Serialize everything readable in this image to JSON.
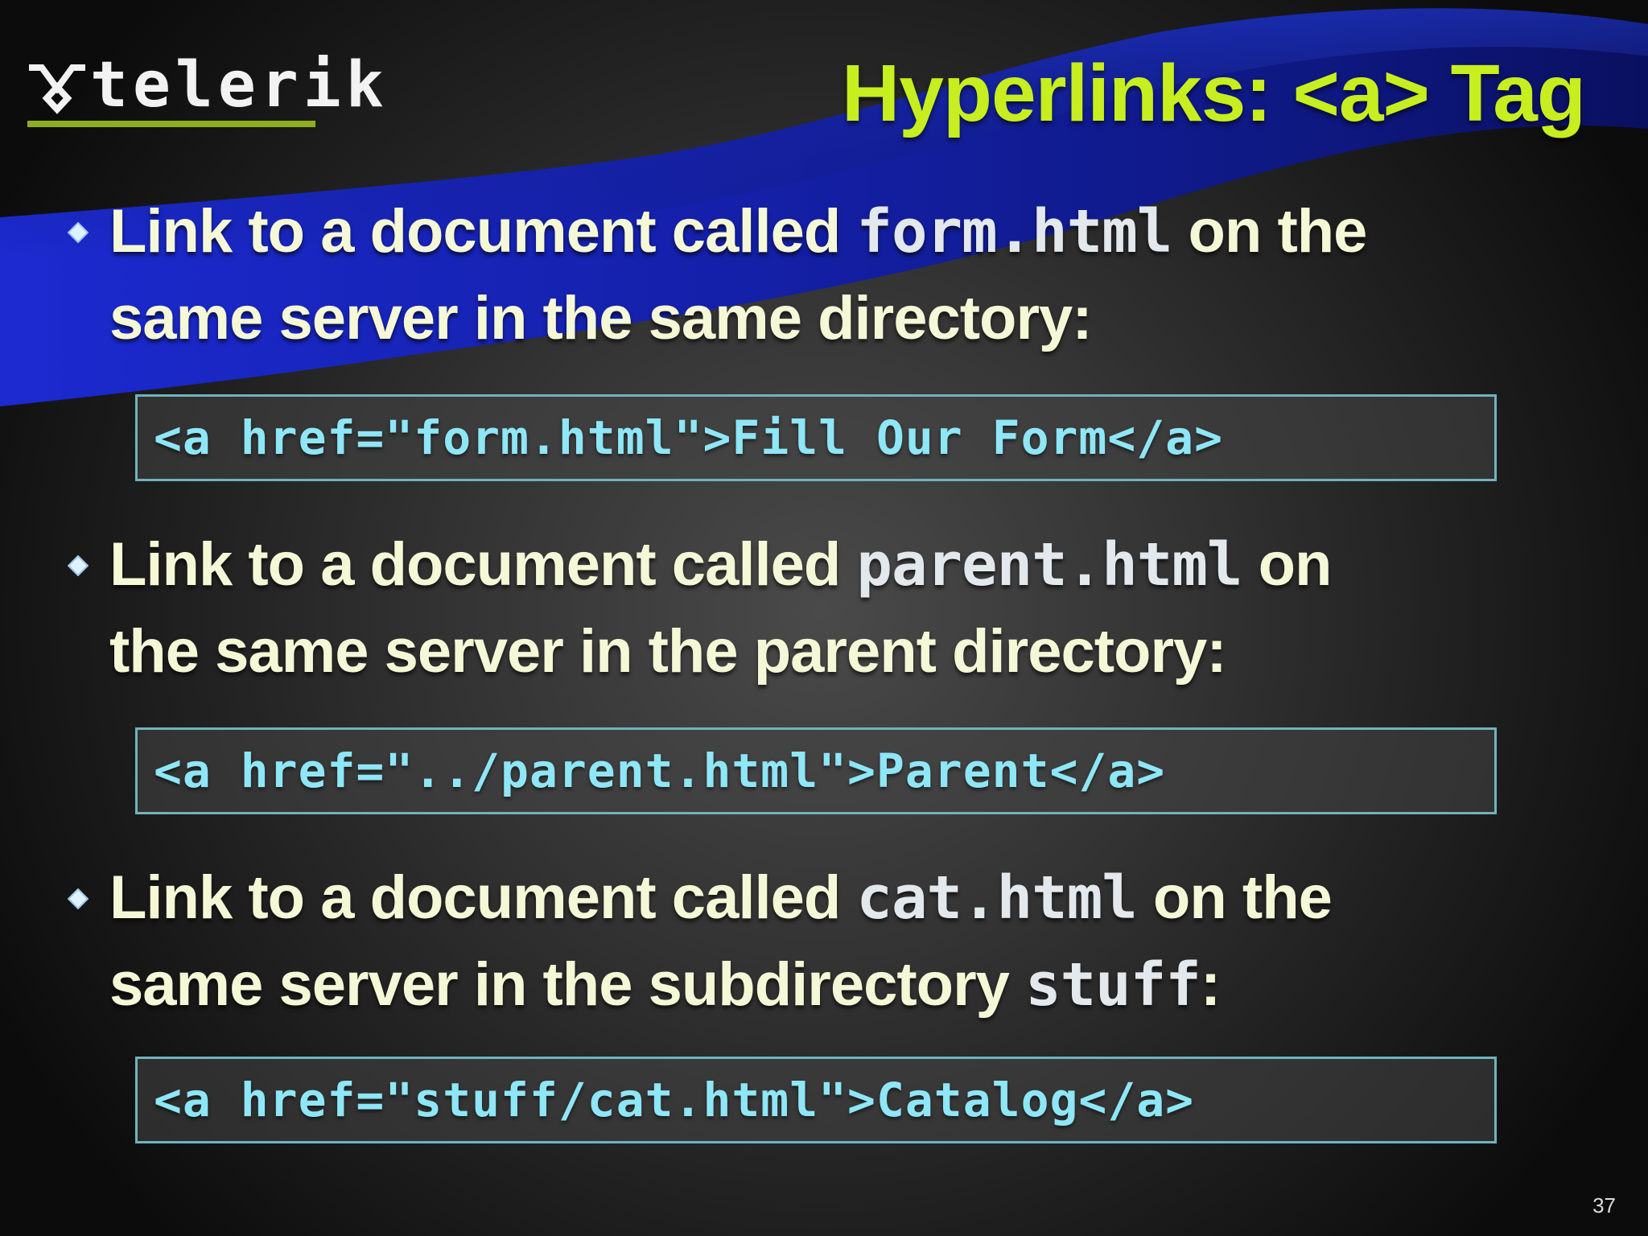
{
  "logo": {
    "text": "telerik",
    "mark_icon": "telerik-logo-mark-icon"
  },
  "title": "Hyperlinks: <a> Tag",
  "bullets": [
    {
      "icon": "diamond-bullet-icon",
      "line1_pre": "Link to a document called ",
      "line1_code": "form.html",
      "line1_post": " on the",
      "line2_pre": "same server in the same directory:",
      "line2_code": "",
      "line2_post": "",
      "code_sample": "<a href=\"form.html\">Fill Our Form</a>"
    },
    {
      "icon": "diamond-bullet-icon",
      "line1_pre": "Link to a document called ",
      "line1_code": "parent.html",
      "line1_post": " on",
      "line2_pre": "the same server in the parent directory:",
      "line2_code": "",
      "line2_post": "",
      "code_sample": "<a href=\"../parent.html\">Parent</a>"
    },
    {
      "icon": "diamond-bullet-icon",
      "line1_pre": "Link to a document called ",
      "line1_code": "cat.html",
      "line1_post": " on the",
      "line2_pre": "same server in the subdirectory ",
      "line2_code": "stuff",
      "line2_post": ":",
      "code_sample": "<a href=\"stuff/cat.html\">Catalog</a>"
    }
  ],
  "page_number": "37",
  "colors": {
    "title": "#c7ee1e",
    "bullet_text": "#f5f8d6",
    "code_text": "#8ee6f6",
    "code_border": "#6fb4bd",
    "logo_underline": "#8fae1b",
    "swoosh_blue": "#1a24b8"
  }
}
